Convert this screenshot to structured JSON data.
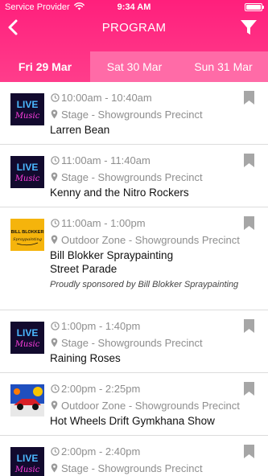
{
  "status_bar": {
    "carrier": "Service Provider",
    "time": "9:34 AM"
  },
  "header": {
    "title": "PROGRAM",
    "back_icon": "chevron-left-icon",
    "filter_icon": "filter-icon",
    "color": "#ff1f7c"
  },
  "tabs": [
    {
      "label": "Fri 29 Mar",
      "selected": true
    },
    {
      "label": "Sat 30 Mar",
      "selected": false
    },
    {
      "label": "Sun 31 Mar",
      "selected": false
    }
  ],
  "events": [
    {
      "time": "10:00am - 10:40am",
      "location": "Stage - Showgrounds Precinct",
      "title": "Larren Bean",
      "thumb": "live-music",
      "bookmarked": false
    },
    {
      "time": "11:00am - 11:40am",
      "location": "Stage - Showgrounds Precinct",
      "title": "Kenny and the Nitro Rockers",
      "thumb": "live-music",
      "bookmarked": false
    },
    {
      "time": "11:00am - 1:00pm",
      "location": "Outdoor Zone - Showgrounds Precinct",
      "title_lines": [
        "Bill Blokker Spraypainting",
        "Street Parade"
      ],
      "sponsor": "Proudly sponsored by Bill Blokker Spraypainting",
      "thumb": "bill-blokker",
      "bookmarked": false
    },
    {
      "time": "1:00pm - 1:40pm",
      "location": "Stage - Showgrounds Precinct",
      "title": "Raining Roses",
      "thumb": "live-music",
      "bookmarked": false
    },
    {
      "time": "2:00pm - 2:25pm",
      "location": "Outdoor Zone - Showgrounds Precinct",
      "title": "Hot Wheels Drift Gymkhana Show",
      "thumb": "hot-wheels",
      "bookmarked": false
    },
    {
      "time": "2:00pm - 2:40pm",
      "location": "Stage - Showgrounds Precinct",
      "title": "",
      "thumb": "live-music",
      "bookmarked": false
    }
  ],
  "thumb_text": {
    "live": "LIVE",
    "music": "Music",
    "bill_blokker": "BILL BLOKKER",
    "spray": "Spraypainting"
  }
}
